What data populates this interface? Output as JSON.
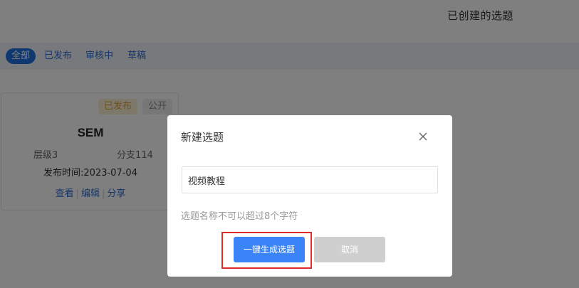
{
  "header": {
    "title": "已创建的选题"
  },
  "filters": {
    "tabs": [
      {
        "label": "全部",
        "active": true
      },
      {
        "label": "已发布",
        "active": false
      },
      {
        "label": "审核中",
        "active": false
      },
      {
        "label": "草稿",
        "active": false
      }
    ]
  },
  "card": {
    "tags": {
      "status": "已发布",
      "visibility": "公开"
    },
    "title": "SEM",
    "level": "层级3",
    "branches": "分支114",
    "published_at": "发布时间:2023-07-04",
    "actions": {
      "view": "查看",
      "edit": "编辑",
      "share": "分享"
    },
    "separator": "|"
  },
  "modal": {
    "title": "新建选题",
    "close_icon": "close-icon",
    "input_value": "视频教程",
    "hint": "选题名称不可以超过8个字符",
    "primary_label": "一键生成选题",
    "cancel_label": "取消",
    "accent_color": "#3a84f7",
    "highlight_color": "#e02b2b"
  }
}
